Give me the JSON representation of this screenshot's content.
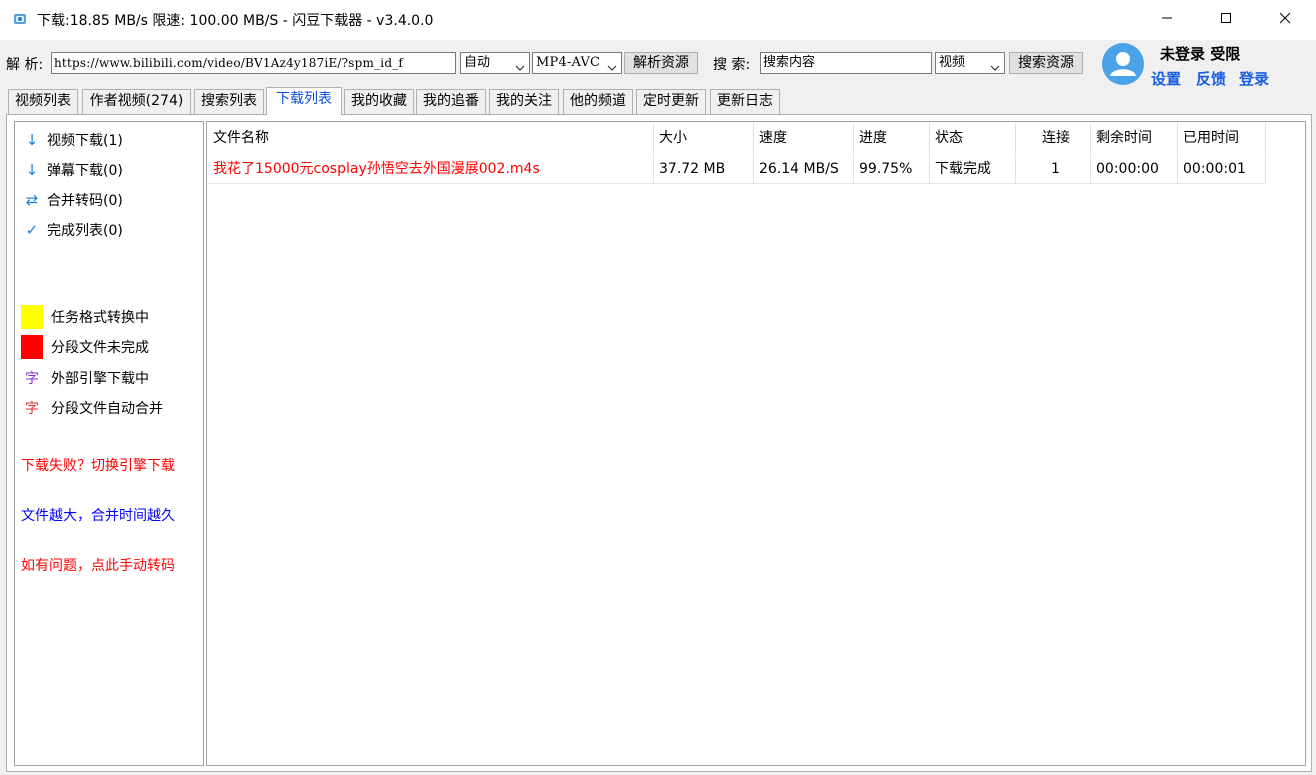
{
  "window": {
    "title": "下载:18.85 MB/s  限速: 100.00 MB/S  - 闪豆下载器 - v3.4.0.0",
    "icons": {
      "app": "app-logo-icon",
      "minimize": "minimize-icon",
      "maximize": "maximize-icon",
      "close": "close-icon"
    }
  },
  "toolbar": {
    "parse_label": "解 析:",
    "url_value": "https://www.bilibili.com/video/BV1Az4y187iE/?spm_id_f",
    "quality_value": "自动",
    "format_value": "MP4-AVC",
    "parse_button": "解析资源",
    "search_label": "搜 索:",
    "search_value": "搜索内容",
    "search_type_value": "视频",
    "search_button": "搜索资源"
  },
  "user": {
    "status": "未登录  受限",
    "settings": "设置",
    "feedback": "反馈",
    "login": "登录",
    "avatar_icon": "user-avatar-icon",
    "accent": "#1b5fe0"
  },
  "tabs": [
    {
      "label": "视频列表",
      "active": false
    },
    {
      "label": "作者视频(274)",
      "active": false
    },
    {
      "label": "搜索列表",
      "active": false
    },
    {
      "label": "下载列表",
      "active": true
    },
    {
      "label": "我的收藏",
      "active": false
    },
    {
      "label": "我的追番",
      "active": false
    },
    {
      "label": "我的关注",
      "active": false
    },
    {
      "label": "他的频道",
      "active": false
    },
    {
      "label": "定时更新",
      "active": false
    },
    {
      "label": "更新日志",
      "active": false
    }
  ],
  "sidebar": {
    "items": [
      {
        "label": "视频下载(1)",
        "icon": "arrow-down-icon"
      },
      {
        "label": "弹幕下载(0)",
        "icon": "arrow-down-icon"
      },
      {
        "label": "合并转码(0)",
        "icon": "swap-arrows-icon"
      },
      {
        "label": "完成列表(0)",
        "icon": "checkmark-icon"
      }
    ],
    "legend": [
      {
        "label": "任务格式转换中",
        "color": "#ffff00"
      },
      {
        "label": "分段文件未完成",
        "color": "#ff0000"
      },
      {
        "label": "外部引擎下载中",
        "glyph": "字",
        "color": "#8a2be2"
      },
      {
        "label": "分段文件自动合并",
        "glyph": "字",
        "color": "#e03030"
      }
    ],
    "notes": [
      {
        "text": "下载失败？切换引擎下载",
        "color": "#ff0000"
      },
      {
        "text": "文件越大，合并时间越久",
        "color": "#0000ff"
      },
      {
        "text": "如有问题，点此手动转码",
        "color": "#ff0000"
      }
    ]
  },
  "download_list": {
    "columns": [
      "文件名称",
      "大小",
      "速度",
      "进度",
      "状态",
      "连接",
      "剩余时间",
      "已用时间"
    ],
    "rows": [
      {
        "name": "我花了15000元cosplay孙悟空去外国漫展002.m4s",
        "size": "37.72 MB",
        "speed": "26.14 MB/S",
        "progress": "99.75%",
        "status": "下载完成",
        "connections": "1",
        "remaining": "00:00:00",
        "elapsed": "00:00:01",
        "name_color": "#ff0000"
      }
    ]
  }
}
